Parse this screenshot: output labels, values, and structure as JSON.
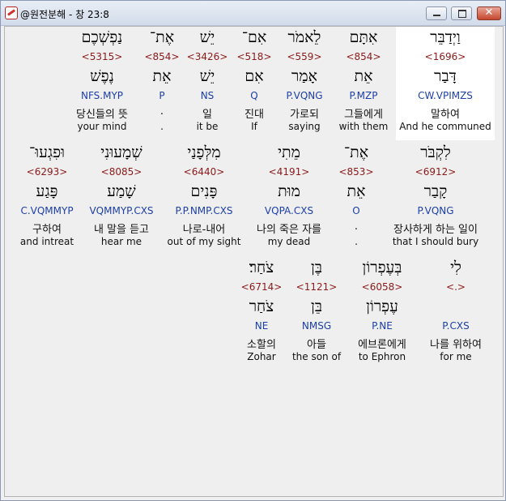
{
  "window": {
    "title": "@원전분해 - 창 23:8",
    "close_glyph": "✕"
  },
  "words": [
    {
      "heb_top": "וַיְדַבֵּר",
      "strong": "<1696>",
      "heb_lemma": "דָּבַר",
      "morph": "CW.VPIMZS",
      "kor": "말하여",
      "eng": "And he communed",
      "highlight": true
    },
    {
      "heb_top": "אִתָּם",
      "strong": "<854>",
      "heb_lemma": "אֵת",
      "morph": "P.MZP",
      "kor": "그들에게",
      "eng": "with them",
      "highlight": false
    },
    {
      "heb_top": "לֵאמֹר",
      "strong": "<559>",
      "heb_lemma": "אָמַר",
      "morph": "P.VQNG",
      "kor": "가로되",
      "eng": "saying",
      "highlight": false
    },
    {
      "heb_top": "אִם־",
      "strong": "<518>",
      "heb_lemma": "אִם",
      "morph": "Q",
      "kor": "진대",
      "eng": "If",
      "highlight": false
    },
    {
      "heb_top": "יֵשׁ",
      "strong": "<3426>",
      "heb_lemma": "יֵשׁ",
      "morph": "NS",
      "kor": "일",
      "eng": "it be",
      "highlight": false
    },
    {
      "heb_top": "אֶת־",
      "strong": "<854>",
      "heb_lemma": "אֵת",
      "morph": "P",
      "kor": ".",
      "eng": ".",
      "highlight": false
    },
    {
      "heb_top": "נַפְשְׁכֶם",
      "strong": "<5315>",
      "heb_lemma": "נֶפֶשׁ",
      "morph": "NFS.MYP",
      "kor": "당신들의 뜻",
      "eng": "your mind",
      "highlight": false
    },
    {
      "heb_top": "לִקְבֹּר",
      "strong": "<6912>",
      "heb_lemma": "קָבַר",
      "morph": "P.VQNG",
      "kor": "장사하게 하는 일이",
      "eng": "that I should bury",
      "highlight": false
    },
    {
      "heb_top": "אֶת־",
      "strong": "<853>",
      "heb_lemma": "אֵת",
      "morph": "O",
      "kor": ".",
      "eng": ".",
      "highlight": false
    },
    {
      "heb_top": "מֵתִי",
      "strong": "<4191>",
      "heb_lemma": "מוּת",
      "morph": "VQPA.CXS",
      "kor": "나의 죽은 자를",
      "eng": "my dead",
      "highlight": false
    },
    {
      "heb_top": "מִלְּפָנַי",
      "strong": "<6440>",
      "heb_lemma": "פָּנִים",
      "morph": "P.P.NMP.CXS",
      "kor": "나로-내어",
      "eng": "out of my sight",
      "highlight": false
    },
    {
      "heb_top": "שְׁמָעוּנִי",
      "strong": "<8085>",
      "heb_lemma": "שָׁמַע",
      "morph": "VQMMYP.CXS",
      "kor": "내 말을 듣고",
      "eng": "hear me",
      "highlight": false
    },
    {
      "heb_top": "וּפִגְעוּ־",
      "strong": "<6293>",
      "heb_lemma": "פָּגַע",
      "morph": "C.VQMMYP",
      "kor": "구하여",
      "eng": "and intreat",
      "highlight": false
    },
    {
      "heb_top": "לִי",
      "strong": "<.>",
      "heb_lemma": "",
      "morph": "P.CXS",
      "kor": "나를 위하여",
      "eng": "for me",
      "highlight": false
    },
    {
      "heb_top": "בְּעֶפְרוֹן",
      "strong": "<6058>",
      "heb_lemma": "עֶפְרוֹן",
      "morph": "P.NE",
      "kor": "에브론에게",
      "eng": "to Ephron",
      "highlight": false
    },
    {
      "heb_top": "בֶּן",
      "strong": "<1121>",
      "heb_lemma": "בֵּן",
      "morph": "NMSG",
      "kor": "아들",
      "eng": "the son of",
      "highlight": false
    },
    {
      "heb_top": "צֹחַר׃",
      "strong": "<6714>",
      "heb_lemma": "צֹחַר",
      "morph": "NE",
      "kor": "소할의",
      "eng": "Zohar",
      "highlight": false
    }
  ]
}
